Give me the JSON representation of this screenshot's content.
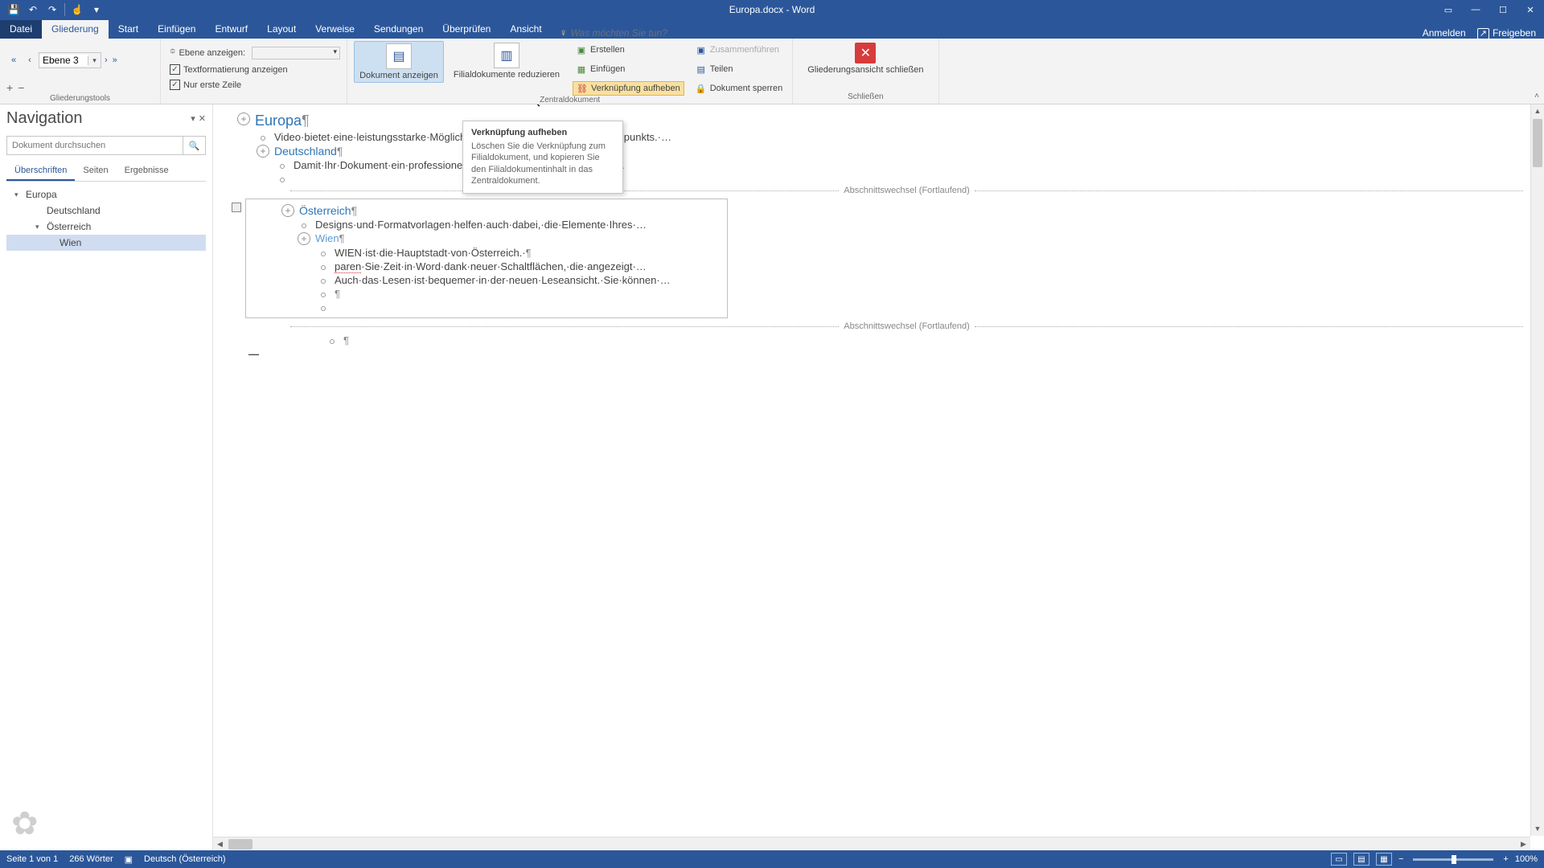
{
  "title": "Europa.docx - Word",
  "qat": {
    "save": "💾",
    "undo": "↶",
    "redo": "↷",
    "touch": "☝",
    "more": "▾"
  },
  "tabs": {
    "file": "Datei",
    "active": "Gliederung",
    "start": "Start",
    "einfuegen": "Einfügen",
    "entwurf": "Entwurf",
    "layout": "Layout",
    "verweise": "Verweise",
    "sendungen": "Sendungen",
    "ueberpruefen": "Überprüfen",
    "ansicht": "Ansicht",
    "tellme_placeholder": "Was möchten Sie tun?",
    "anmelden": "Anmelden",
    "freigeben": "Freigeben"
  },
  "ribbon": {
    "level_value": "Ebene 3",
    "show_level": "Ebene anzeigen:",
    "text_format": "Textformatierung anzeigen",
    "only_first": "Nur erste Zeile",
    "group_tools": "Gliederungstools",
    "doc_show": "Dokument anzeigen",
    "sub_reduce": "Filialdokumente reduzieren",
    "create": "Erstellen",
    "insert": "Einfügen",
    "unlink": "Verknüpfung aufheben",
    "merge": "Zusammenführen",
    "split": "Teilen",
    "lock": "Dokument sperren",
    "group_master": "Zentraldokument",
    "close_view": "Gliederungsansicht schließen",
    "group_close": "Schließen"
  },
  "tooltip": {
    "title": "Verknüpfung aufheben",
    "body": "Löschen Sie die Verknüpfung zum Filialdokument, und kopieren Sie den Filialdokumentinhalt in das Zentraldokument."
  },
  "nav": {
    "title": "Navigation",
    "search_placeholder": "Dokument durchsuchen",
    "tab_headings": "Überschriften",
    "tab_pages": "Seiten",
    "tab_results": "Ergebnisse",
    "tree": {
      "europa": "Europa",
      "deutschland": "Deutschland",
      "oesterreich": "Österreich",
      "wien": "Wien"
    }
  },
  "doc": {
    "europa": "Europa",
    "video": "Video·bietet·eine·leistungsstarke·Möglichkeit zur Unterstützung Ihres Standpunkts.·…",
    "deutschland": "Deutschland",
    "damit": "Damit·Ihr·Dokument·ein·professionelles Aussehen erhält, stellt Word·…",
    "section": "Abschnittswechsel (Fortlaufend)",
    "oesterreich": "Österreich",
    "designs": "Designs·und·Formatvorlagen·helfen·auch·dabei,·die·Elemente·Ihres·…",
    "wien": "Wien",
    "wien_body": "WIEN·ist·die·Hauptstadt·von·Österreich.·",
    "paren": "paren",
    "paren_rest": "·Sie·Zeit·in·Word·dank·neuer·Schaltflächen,·die·angezeigt·…",
    "auchlesen": "Auch·das·Lesen·ist·bequemer·in·der·neuen·Leseansicht.·Sie·können·…",
    "pilcrow": "¶"
  },
  "status": {
    "page": "Seite 1 von 1",
    "words": "266 Wörter",
    "lang": "Deutsch (Österreich)",
    "zoom": "100%"
  }
}
